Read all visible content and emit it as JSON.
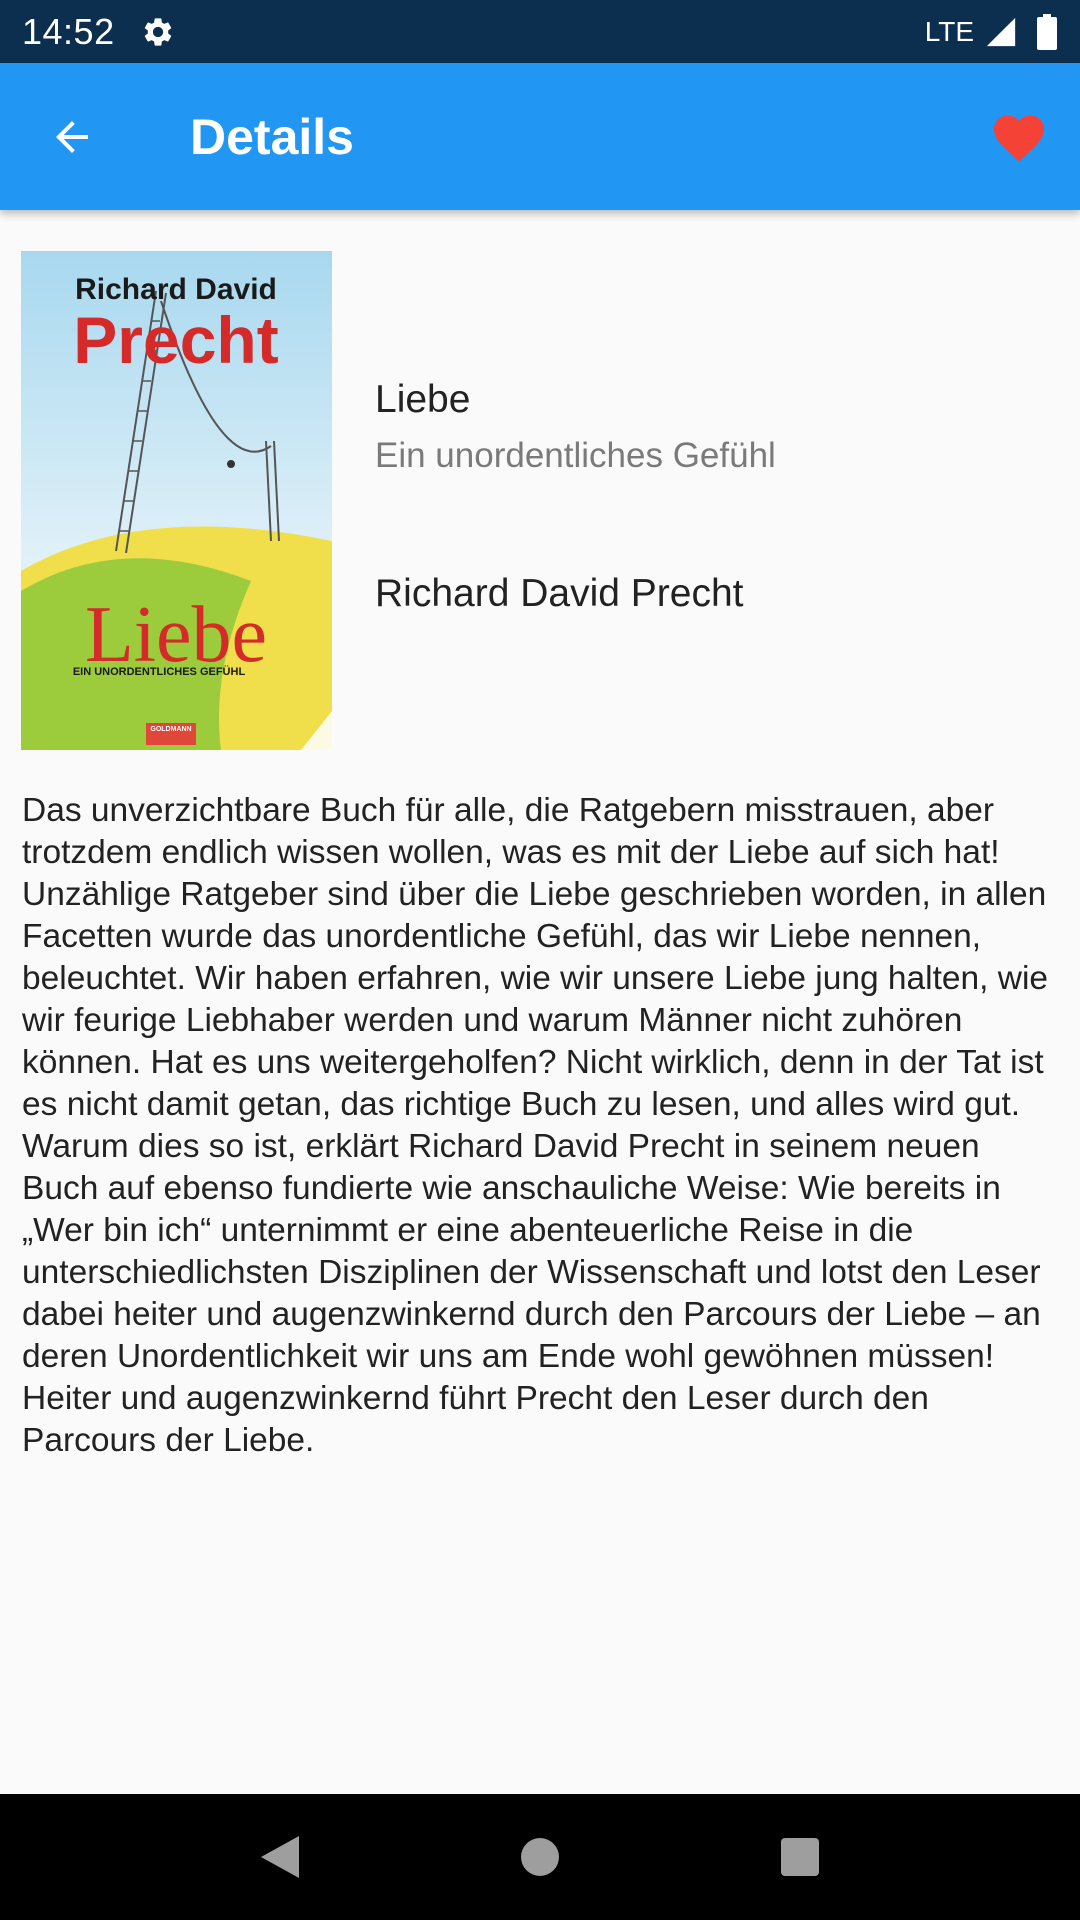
{
  "status_bar": {
    "time": "14:52",
    "network": "LTE",
    "icons": [
      "gear-icon",
      "signal-icon",
      "battery-icon"
    ]
  },
  "app_bar": {
    "title": "Details",
    "background": "#2196f3",
    "icons": [
      "back-arrow-icon",
      "heart-icon"
    ],
    "favorite_color": "#f44336"
  },
  "book": {
    "cover": {
      "author_line": "Richard David",
      "author_surname": "Precht",
      "title": "Liebe",
      "subtitle": "EIN UNORDENTLICHES GEFÜHL",
      "publisher": "GOLDMANN"
    },
    "title": "Liebe",
    "subtitle": "Ein unordentliches Gefühl",
    "author": "Richard David Precht",
    "description": "Das unverzichtbare Buch für alle, die Ratgebern misstrauen, aber trotzdem endlich wissen wollen, was es mit der Liebe auf sich hat! Unzählige Ratgeber sind über die Liebe geschrieben worden, in allen Facetten wurde das unordentliche Gefühl, das wir Liebe nennen, beleuchtet. Wir haben erfahren, wie wir unsere Liebe jung halten, wie wir feurige Liebhaber werden und warum Männer nicht zuhören können. Hat es uns weitergeholfen? Nicht wirklich, denn in der Tat ist es nicht damit getan, das richtige Buch zu lesen, und alles wird gut. Warum dies so ist, erklärt Richard David Precht in seinem neuen Buch auf ebenso fundierte wie anschauliche Weise: Wie bereits in „Wer bin ich“ unternimmt er eine abenteuerliche Reise in die unterschiedlichsten Disziplinen der Wissenschaft und lotst den Leser dabei heiter und augenzwinkernd durch den Parcours der Liebe – an deren Unordentlichkeit wir uns am Ende wohl gewöhnen müssen! Heiter und augenzwinkernd führt Precht den Leser durch den Parcours der Liebe."
  },
  "nav_bar": {
    "icons": [
      "back-triangle-icon",
      "home-circle-icon",
      "recents-square-icon"
    ]
  }
}
